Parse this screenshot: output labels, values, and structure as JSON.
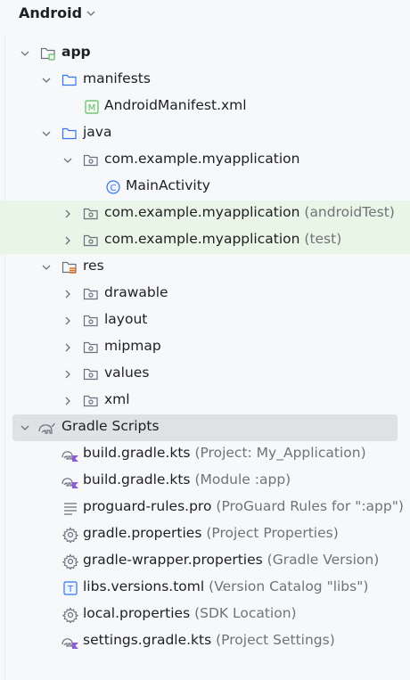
{
  "header": {
    "title": "Android"
  },
  "tree": {
    "app": "app",
    "manifests": "manifests",
    "android_manifest": "AndroidManifest.xml",
    "java": "java",
    "pkg_main": "com.example.myapplication",
    "main_activity": "MainActivity",
    "pkg_android_test": "com.example.myapplication",
    "pkg_android_test_suffix": "(androidTest)",
    "pkg_test": "com.example.myapplication",
    "pkg_test_suffix": "(test)",
    "res": "res",
    "drawable": "drawable",
    "layout": "layout",
    "mipmap": "mipmap",
    "values": "values",
    "xml": "xml",
    "gradle_scripts": "Gradle Scripts",
    "build_project": "build.gradle.kts",
    "build_project_suffix": "(Project: My_Application)",
    "build_module": "build.gradle.kts",
    "build_module_suffix": "(Module :app)",
    "proguard": "proguard-rules.pro",
    "proguard_suffix": "(ProGuard Rules for \":app\")",
    "gradle_props": "gradle.properties",
    "gradle_props_suffix": "(Project Properties)",
    "wrapper_props": "gradle-wrapper.properties",
    "wrapper_props_suffix": "(Gradle Version)",
    "libs_versions": "libs.versions.toml",
    "libs_versions_suffix": "(Version Catalog \"libs\")",
    "local_props": "local.properties",
    "local_props_suffix": "(SDK Location)",
    "settings_gradle": "settings.gradle.kts",
    "settings_gradle_suffix": "(Project Settings)"
  },
  "colors": {
    "test_highlight": "#e9f5e6",
    "selected_row": "#dfe1e5",
    "secondary_text": "#6f737a",
    "folder_stroke": "#6c707e",
    "java_folder": "#3574f0",
    "res_folder_accent": "#e66d17",
    "manifest_icon": "#5fb865",
    "class_icon": "#3574f0",
    "kotlin_purple": "#8e5bd9"
  }
}
